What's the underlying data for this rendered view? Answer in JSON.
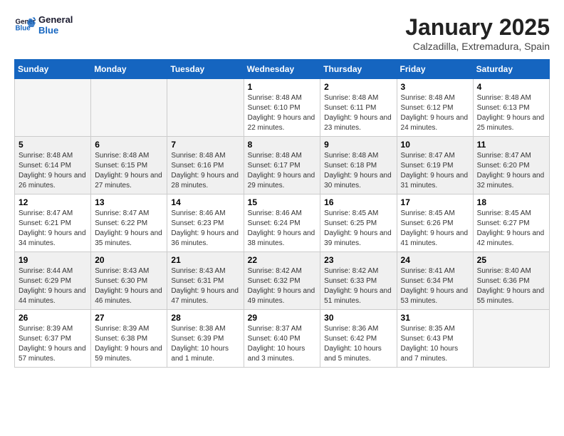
{
  "header": {
    "logo_line1": "General",
    "logo_line2": "Blue",
    "month": "January 2025",
    "location": "Calzadilla, Extremadura, Spain"
  },
  "weekdays": [
    "Sunday",
    "Monday",
    "Tuesday",
    "Wednesday",
    "Thursday",
    "Friday",
    "Saturday"
  ],
  "weeks": [
    [
      {
        "day": "",
        "info": ""
      },
      {
        "day": "",
        "info": ""
      },
      {
        "day": "",
        "info": ""
      },
      {
        "day": "1",
        "info": "Sunrise: 8:48 AM\nSunset: 6:10 PM\nDaylight: 9 hours and 22 minutes."
      },
      {
        "day": "2",
        "info": "Sunrise: 8:48 AM\nSunset: 6:11 PM\nDaylight: 9 hours and 23 minutes."
      },
      {
        "day": "3",
        "info": "Sunrise: 8:48 AM\nSunset: 6:12 PM\nDaylight: 9 hours and 24 minutes."
      },
      {
        "day": "4",
        "info": "Sunrise: 8:48 AM\nSunset: 6:13 PM\nDaylight: 9 hours and 25 minutes."
      }
    ],
    [
      {
        "day": "5",
        "info": "Sunrise: 8:48 AM\nSunset: 6:14 PM\nDaylight: 9 hours and 26 minutes."
      },
      {
        "day": "6",
        "info": "Sunrise: 8:48 AM\nSunset: 6:15 PM\nDaylight: 9 hours and 27 minutes."
      },
      {
        "day": "7",
        "info": "Sunrise: 8:48 AM\nSunset: 6:16 PM\nDaylight: 9 hours and 28 minutes."
      },
      {
        "day": "8",
        "info": "Sunrise: 8:48 AM\nSunset: 6:17 PM\nDaylight: 9 hours and 29 minutes."
      },
      {
        "day": "9",
        "info": "Sunrise: 8:48 AM\nSunset: 6:18 PM\nDaylight: 9 hours and 30 minutes."
      },
      {
        "day": "10",
        "info": "Sunrise: 8:47 AM\nSunset: 6:19 PM\nDaylight: 9 hours and 31 minutes."
      },
      {
        "day": "11",
        "info": "Sunrise: 8:47 AM\nSunset: 6:20 PM\nDaylight: 9 hours and 32 minutes."
      }
    ],
    [
      {
        "day": "12",
        "info": "Sunrise: 8:47 AM\nSunset: 6:21 PM\nDaylight: 9 hours and 34 minutes."
      },
      {
        "day": "13",
        "info": "Sunrise: 8:47 AM\nSunset: 6:22 PM\nDaylight: 9 hours and 35 minutes."
      },
      {
        "day": "14",
        "info": "Sunrise: 8:46 AM\nSunset: 6:23 PM\nDaylight: 9 hours and 36 minutes."
      },
      {
        "day": "15",
        "info": "Sunrise: 8:46 AM\nSunset: 6:24 PM\nDaylight: 9 hours and 38 minutes."
      },
      {
        "day": "16",
        "info": "Sunrise: 8:45 AM\nSunset: 6:25 PM\nDaylight: 9 hours and 39 minutes."
      },
      {
        "day": "17",
        "info": "Sunrise: 8:45 AM\nSunset: 6:26 PM\nDaylight: 9 hours and 41 minutes."
      },
      {
        "day": "18",
        "info": "Sunrise: 8:45 AM\nSunset: 6:27 PM\nDaylight: 9 hours and 42 minutes."
      }
    ],
    [
      {
        "day": "19",
        "info": "Sunrise: 8:44 AM\nSunset: 6:29 PM\nDaylight: 9 hours and 44 minutes."
      },
      {
        "day": "20",
        "info": "Sunrise: 8:43 AM\nSunset: 6:30 PM\nDaylight: 9 hours and 46 minutes."
      },
      {
        "day": "21",
        "info": "Sunrise: 8:43 AM\nSunset: 6:31 PM\nDaylight: 9 hours and 47 minutes."
      },
      {
        "day": "22",
        "info": "Sunrise: 8:42 AM\nSunset: 6:32 PM\nDaylight: 9 hours and 49 minutes."
      },
      {
        "day": "23",
        "info": "Sunrise: 8:42 AM\nSunset: 6:33 PM\nDaylight: 9 hours and 51 minutes."
      },
      {
        "day": "24",
        "info": "Sunrise: 8:41 AM\nSunset: 6:34 PM\nDaylight: 9 hours and 53 minutes."
      },
      {
        "day": "25",
        "info": "Sunrise: 8:40 AM\nSunset: 6:36 PM\nDaylight: 9 hours and 55 minutes."
      }
    ],
    [
      {
        "day": "26",
        "info": "Sunrise: 8:39 AM\nSunset: 6:37 PM\nDaylight: 9 hours and 57 minutes."
      },
      {
        "day": "27",
        "info": "Sunrise: 8:39 AM\nSunset: 6:38 PM\nDaylight: 9 hours and 59 minutes."
      },
      {
        "day": "28",
        "info": "Sunrise: 8:38 AM\nSunset: 6:39 PM\nDaylight: 10 hours and 1 minute."
      },
      {
        "day": "29",
        "info": "Sunrise: 8:37 AM\nSunset: 6:40 PM\nDaylight: 10 hours and 3 minutes."
      },
      {
        "day": "30",
        "info": "Sunrise: 8:36 AM\nSunset: 6:42 PM\nDaylight: 10 hours and 5 minutes."
      },
      {
        "day": "31",
        "info": "Sunrise: 8:35 AM\nSunset: 6:43 PM\nDaylight: 10 hours and 7 minutes."
      },
      {
        "day": "",
        "info": ""
      }
    ]
  ]
}
